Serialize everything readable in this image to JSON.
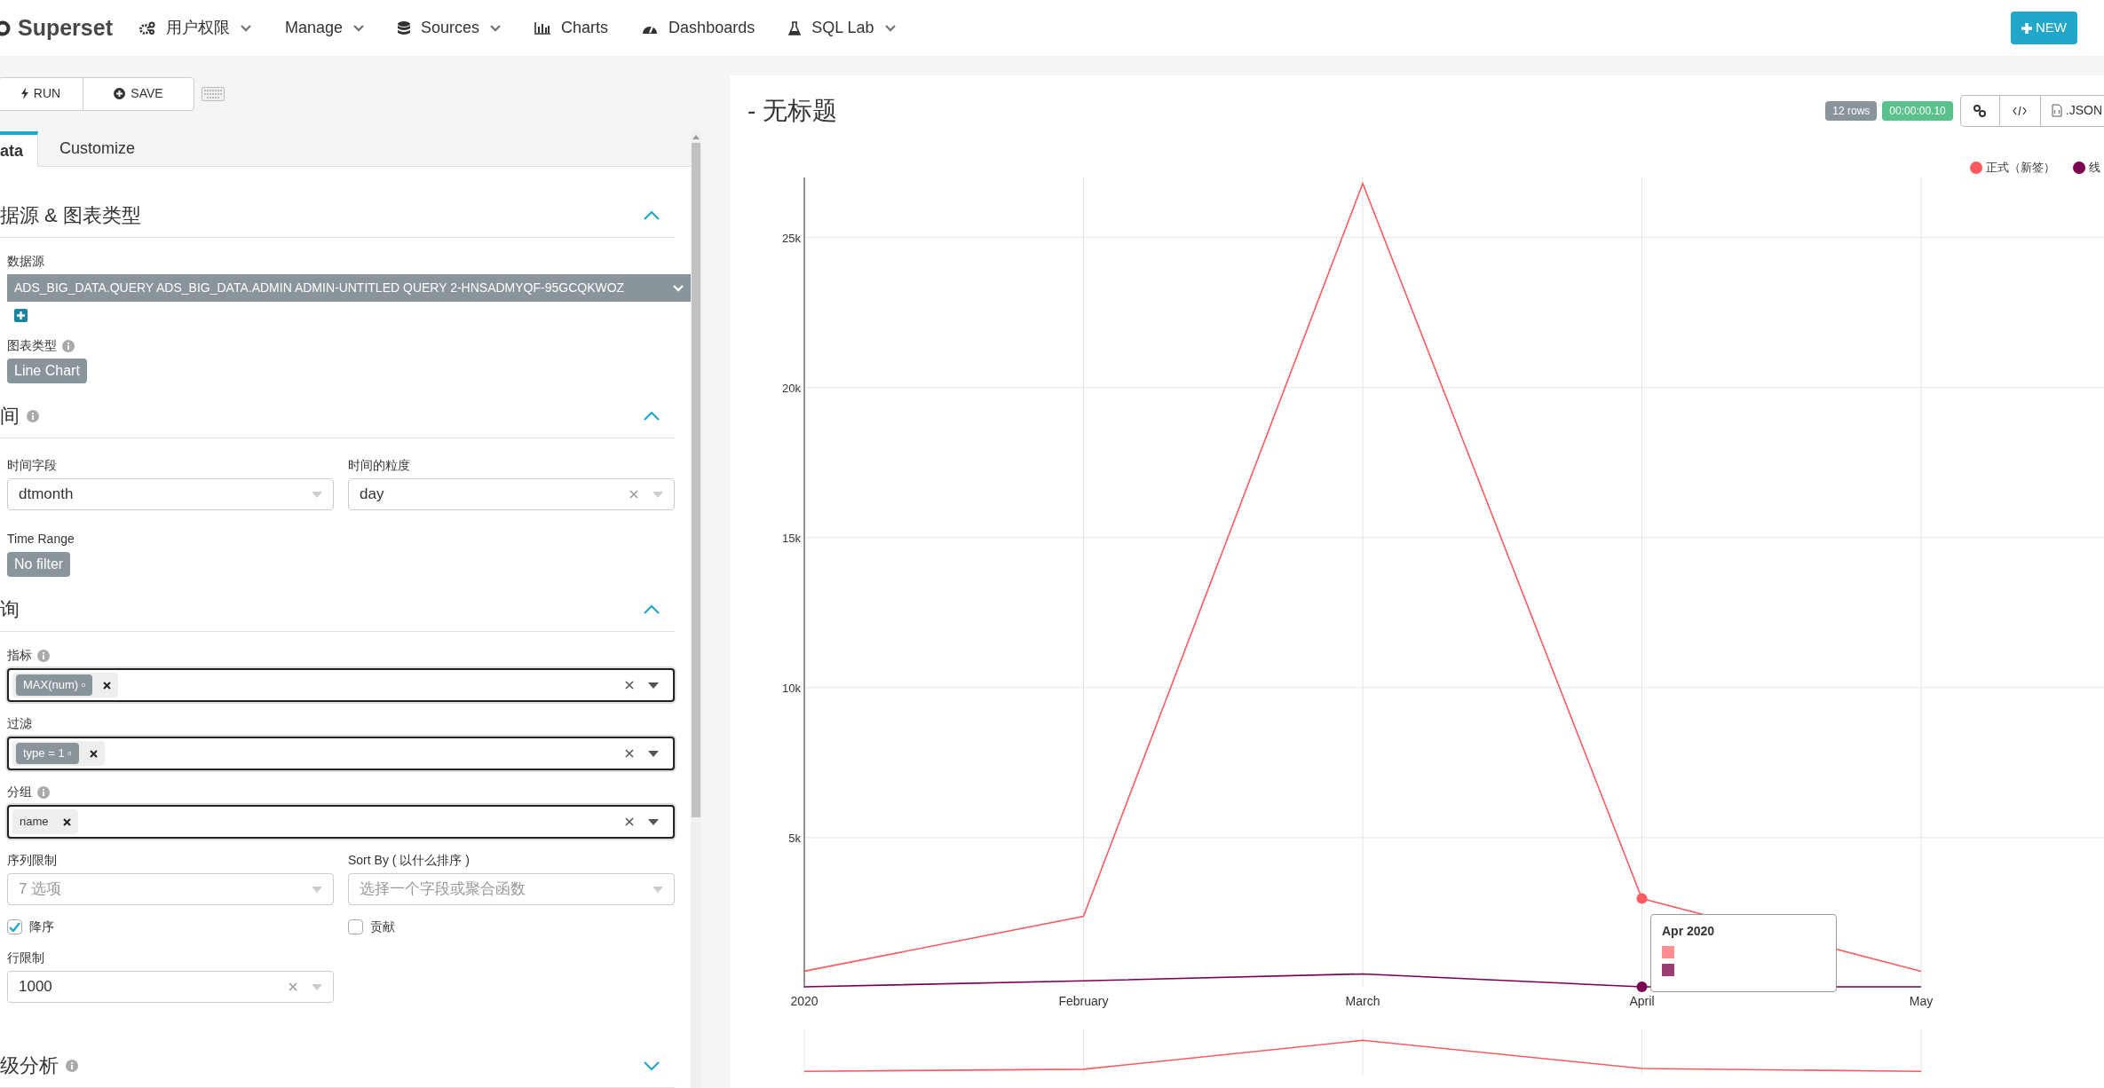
{
  "navbar": {
    "brand": "Superset",
    "items": [
      {
        "label": "用户权限",
        "kind": "gears",
        "dropdown": true
      },
      {
        "label": "Manage",
        "kind": "plain",
        "dropdown": true
      },
      {
        "label": "Sources",
        "kind": "database",
        "dropdown": true
      },
      {
        "label": "Charts",
        "kind": "bars",
        "dropdown": false
      },
      {
        "label": "Dashboards",
        "kind": "gauge",
        "dropdown": false
      },
      {
        "label": "SQL Lab",
        "kind": "flask",
        "dropdown": true
      }
    ],
    "new_button": "NEW"
  },
  "toolbar": {
    "buttons": [
      {
        "label": "RUN",
        "kind": "run"
      },
      {
        "label": "SAVE",
        "kind": "save"
      }
    ]
  },
  "tabs": [
    {
      "label": "ata",
      "selected": true
    },
    {
      "label": "Customize",
      "selected": false
    }
  ],
  "sections": [
    {
      "title": "据源 & 图表类型",
      "info": false,
      "expanded": true
    },
    {
      "title": "间",
      "info": true,
      "expanded": true
    },
    {
      "title": "询",
      "info": false,
      "expanded": true
    },
    {
      "title": "级分析",
      "info": true,
      "expanded": false
    }
  ],
  "datasource": {
    "label": "数据源",
    "value": "ADS_BIG_DATA.QUERY ADS_BIG_DATA.ADMIN ADMIN-UNTITLED QUERY 2-HNSADMYQF-95GCQKWOZ"
  },
  "viz_type": {
    "label": "图表类型",
    "value": "Line Chart"
  },
  "time": {
    "column_label": "时间字段",
    "column_value": "dtmonth",
    "grain_label": "时间的粒度",
    "grain_value": "day",
    "range_label": "Time Range",
    "range_value": "No filter"
  },
  "query": {
    "metrics_label": "指标",
    "metrics": [
      "MAX(num) ▫"
    ],
    "filters_label": "过滤",
    "filters": [
      "type = 1 ▫"
    ],
    "groupby_label": "分组",
    "groupby": [
      "name"
    ],
    "limit_label": "序列限制",
    "limit_placeholder": "7 选项",
    "sort_label": "Sort By ( 以什么排序 )",
    "sort_placeholder": "选择一个字段或聚合函数",
    "checks": [
      {
        "label": "降序",
        "checked": true
      },
      {
        "label": "贡献",
        "checked": false
      }
    ],
    "row_limit_label": "行限制",
    "row_limit": "1000"
  },
  "chart_panel": {
    "title": "- 无标题",
    "rows_badge": "12 rows",
    "time_badge": "00:00:00.10",
    "json_button": ".JSON",
    "tooltip": {
      "title": "Apr 2020",
      "swatches": [
        {
          "color": "#ff8c8f"
        },
        {
          "color": "#9c3c74"
        }
      ]
    },
    "chart_data": {
      "type": "line",
      "grid": true,
      "categories": [
        "2020",
        "February",
        "March",
        "April",
        "May"
      ],
      "series": [
        {
          "name": "正式（新签）",
          "color": "#ff5a5f",
          "values": [
            550,
            2380,
            26800,
            2970,
            550
          ]
        },
        {
          "name": "线",
          "color": "#7b0051",
          "values": [
            30,
            230,
            460,
            30,
            30
          ]
        }
      ],
      "ylim": [
        0,
        27000
      ],
      "yticks": [
        {
          "value": 5000,
          "label": "5k"
        },
        {
          "value": 10000,
          "label": "10k"
        },
        {
          "value": 15000,
          "label": "15k"
        },
        {
          "value": 20000,
          "label": "20k"
        },
        {
          "value": 25000,
          "label": "25k"
        }
      ]
    }
  }
}
